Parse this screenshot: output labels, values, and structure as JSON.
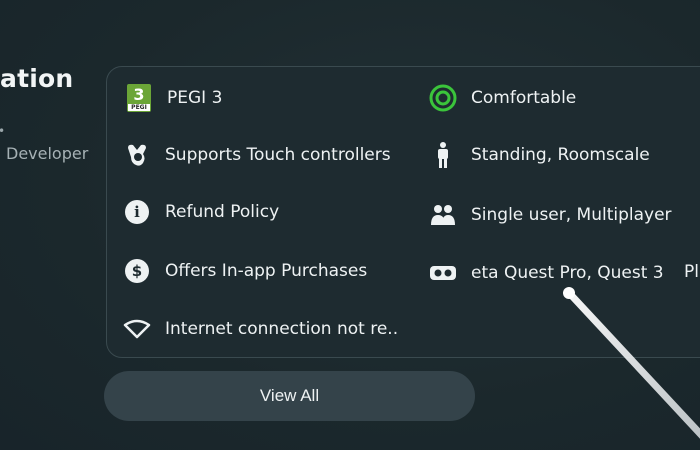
{
  "page": {
    "heading": "ation",
    "developer": "Developer"
  },
  "features": [
    {
      "icon": "pegi-3-icon",
      "label": "PEGI 3",
      "pegi_number": "3",
      "pegi_text": "PEGI"
    },
    {
      "icon": "comfort-circle-icon",
      "label": "Comfortable"
    },
    {
      "icon": "touch-controller-icon",
      "label": "Supports Touch controllers"
    },
    {
      "icon": "standing-person-icon",
      "label": "Standing, Roomscale"
    },
    {
      "icon": "info-icon",
      "label": "Refund Policy",
      "glyph": "i"
    },
    {
      "icon": "users-icon",
      "label": "Single user, Multiplayer"
    },
    {
      "icon": "dollar-icon",
      "label": "Offers In-app Purchases",
      "glyph": "$"
    },
    {
      "icon": "vr-headset-icon",
      "label": "eta Quest Pro, Quest 3",
      "overflow": "Pl"
    },
    {
      "icon": "wifi-icon",
      "label": "Internet connection not re.."
    }
  ],
  "actions": {
    "view_all": "View All"
  },
  "colors": {
    "background": "#1d2a2f",
    "card": "#1e2b30",
    "button": "#34434a",
    "comfort_green": "#3bc43b",
    "pegi_green": "#6ba537"
  }
}
